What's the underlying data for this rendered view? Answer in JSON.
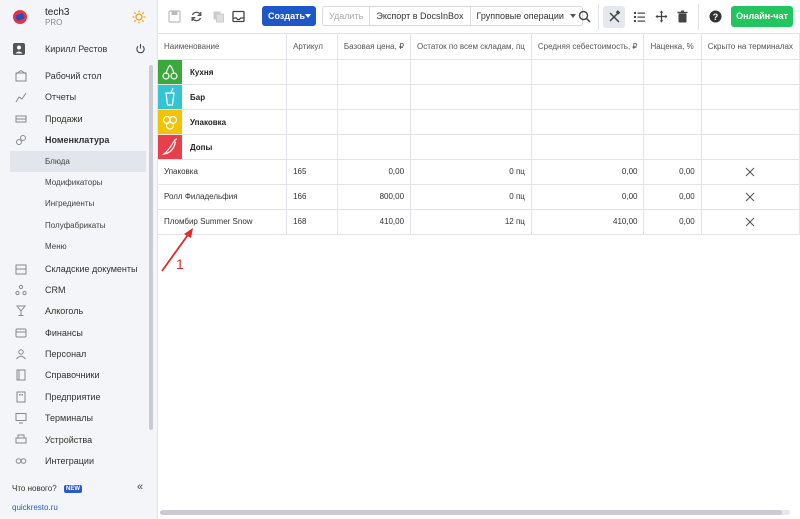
{
  "brand": {
    "name": "tech3",
    "plan": "PRO"
  },
  "user": {
    "name": "Кирилл Рестов"
  },
  "nav": [
    {
      "label": "Рабочий стол",
      "icon": "home-icon",
      "type": "main"
    },
    {
      "label": "Отчеты",
      "icon": "chart-icon",
      "type": "main"
    },
    {
      "label": "Продажи",
      "icon": "cart-icon",
      "type": "main"
    },
    {
      "label": "Номенклатура",
      "icon": "link-icon",
      "type": "main",
      "bold": true
    },
    {
      "label": "Блюда",
      "type": "sub",
      "active": true
    },
    {
      "label": "Модификаторы",
      "type": "sub"
    },
    {
      "label": "Ингредиенты",
      "type": "sub"
    },
    {
      "label": "Полуфабрикаты",
      "type": "sub"
    },
    {
      "label": "Меню",
      "type": "sub"
    },
    {
      "label": "Складские документы",
      "icon": "warehouse-icon",
      "type": "main"
    },
    {
      "label": "CRM",
      "icon": "crm-icon",
      "type": "main"
    },
    {
      "label": "Алкоголь",
      "icon": "glass-icon",
      "type": "main"
    },
    {
      "label": "Финансы",
      "icon": "finance-icon",
      "type": "main"
    },
    {
      "label": "Персонал",
      "icon": "staff-icon",
      "type": "main"
    },
    {
      "label": "Справочники",
      "icon": "book-icon",
      "type": "main"
    },
    {
      "label": "Предприятие",
      "icon": "building-icon",
      "type": "main"
    },
    {
      "label": "Терминалы",
      "icon": "terminal-icon",
      "type": "main"
    },
    {
      "label": "Устройства",
      "icon": "printer-icon",
      "type": "main"
    },
    {
      "label": "Интеграции",
      "icon": "integration-icon",
      "type": "main"
    }
  ],
  "sidebar_footer": {
    "whats_new": "Что нового?",
    "new_badge": "NEW",
    "link": "quickresto.ru"
  },
  "toolbar": {
    "create_label": "Создать",
    "delete_label": "Удалить",
    "export_label": "Экспорт в DocsInBox",
    "group_ops_label": "Групповые операции",
    "chat_label": "Онлайн-чат"
  },
  "table": {
    "headers": [
      "Наименование",
      "Артикул",
      "Базовая цена, ₽",
      "Остаток по всем складам, пц",
      "Средняя себестоимость, ₽",
      "Наценка, %",
      "Скрыто на терминалах"
    ],
    "categories": [
      {
        "label": "Кухня",
        "color": "#3aa83a",
        "icon": "cherries-icon"
      },
      {
        "label": "Бар",
        "color": "#35c4d6",
        "icon": "drink-icon"
      },
      {
        "label": "Упаковка",
        "color": "#f2c300",
        "icon": "package-icon"
      },
      {
        "label": "Допы",
        "color": "#e8404a",
        "icon": "pepper-icon"
      }
    ],
    "rows": [
      {
        "name": "Упаковка",
        "sku": "165",
        "price": "0,00",
        "stock": "0 пц",
        "cost": "0,00",
        "markup": "0,00",
        "hidden": true
      },
      {
        "name": "Ролл Филадельфия",
        "sku": "166",
        "price": "800,00",
        "stock": "0 пц",
        "cost": "0,00",
        "markup": "0,00",
        "hidden": true
      },
      {
        "name": "Пломбир Summer Snow",
        "sku": "168",
        "price": "410,00",
        "stock": "12 пц",
        "cost": "410,00",
        "markup": "0,00",
        "hidden": true
      }
    ]
  },
  "annotation": {
    "number": "1",
    "color": "#e0292b"
  },
  "colors": {
    "accent": "#1e57c6",
    "chat": "#22c55e",
    "brand": "#e8304a"
  }
}
